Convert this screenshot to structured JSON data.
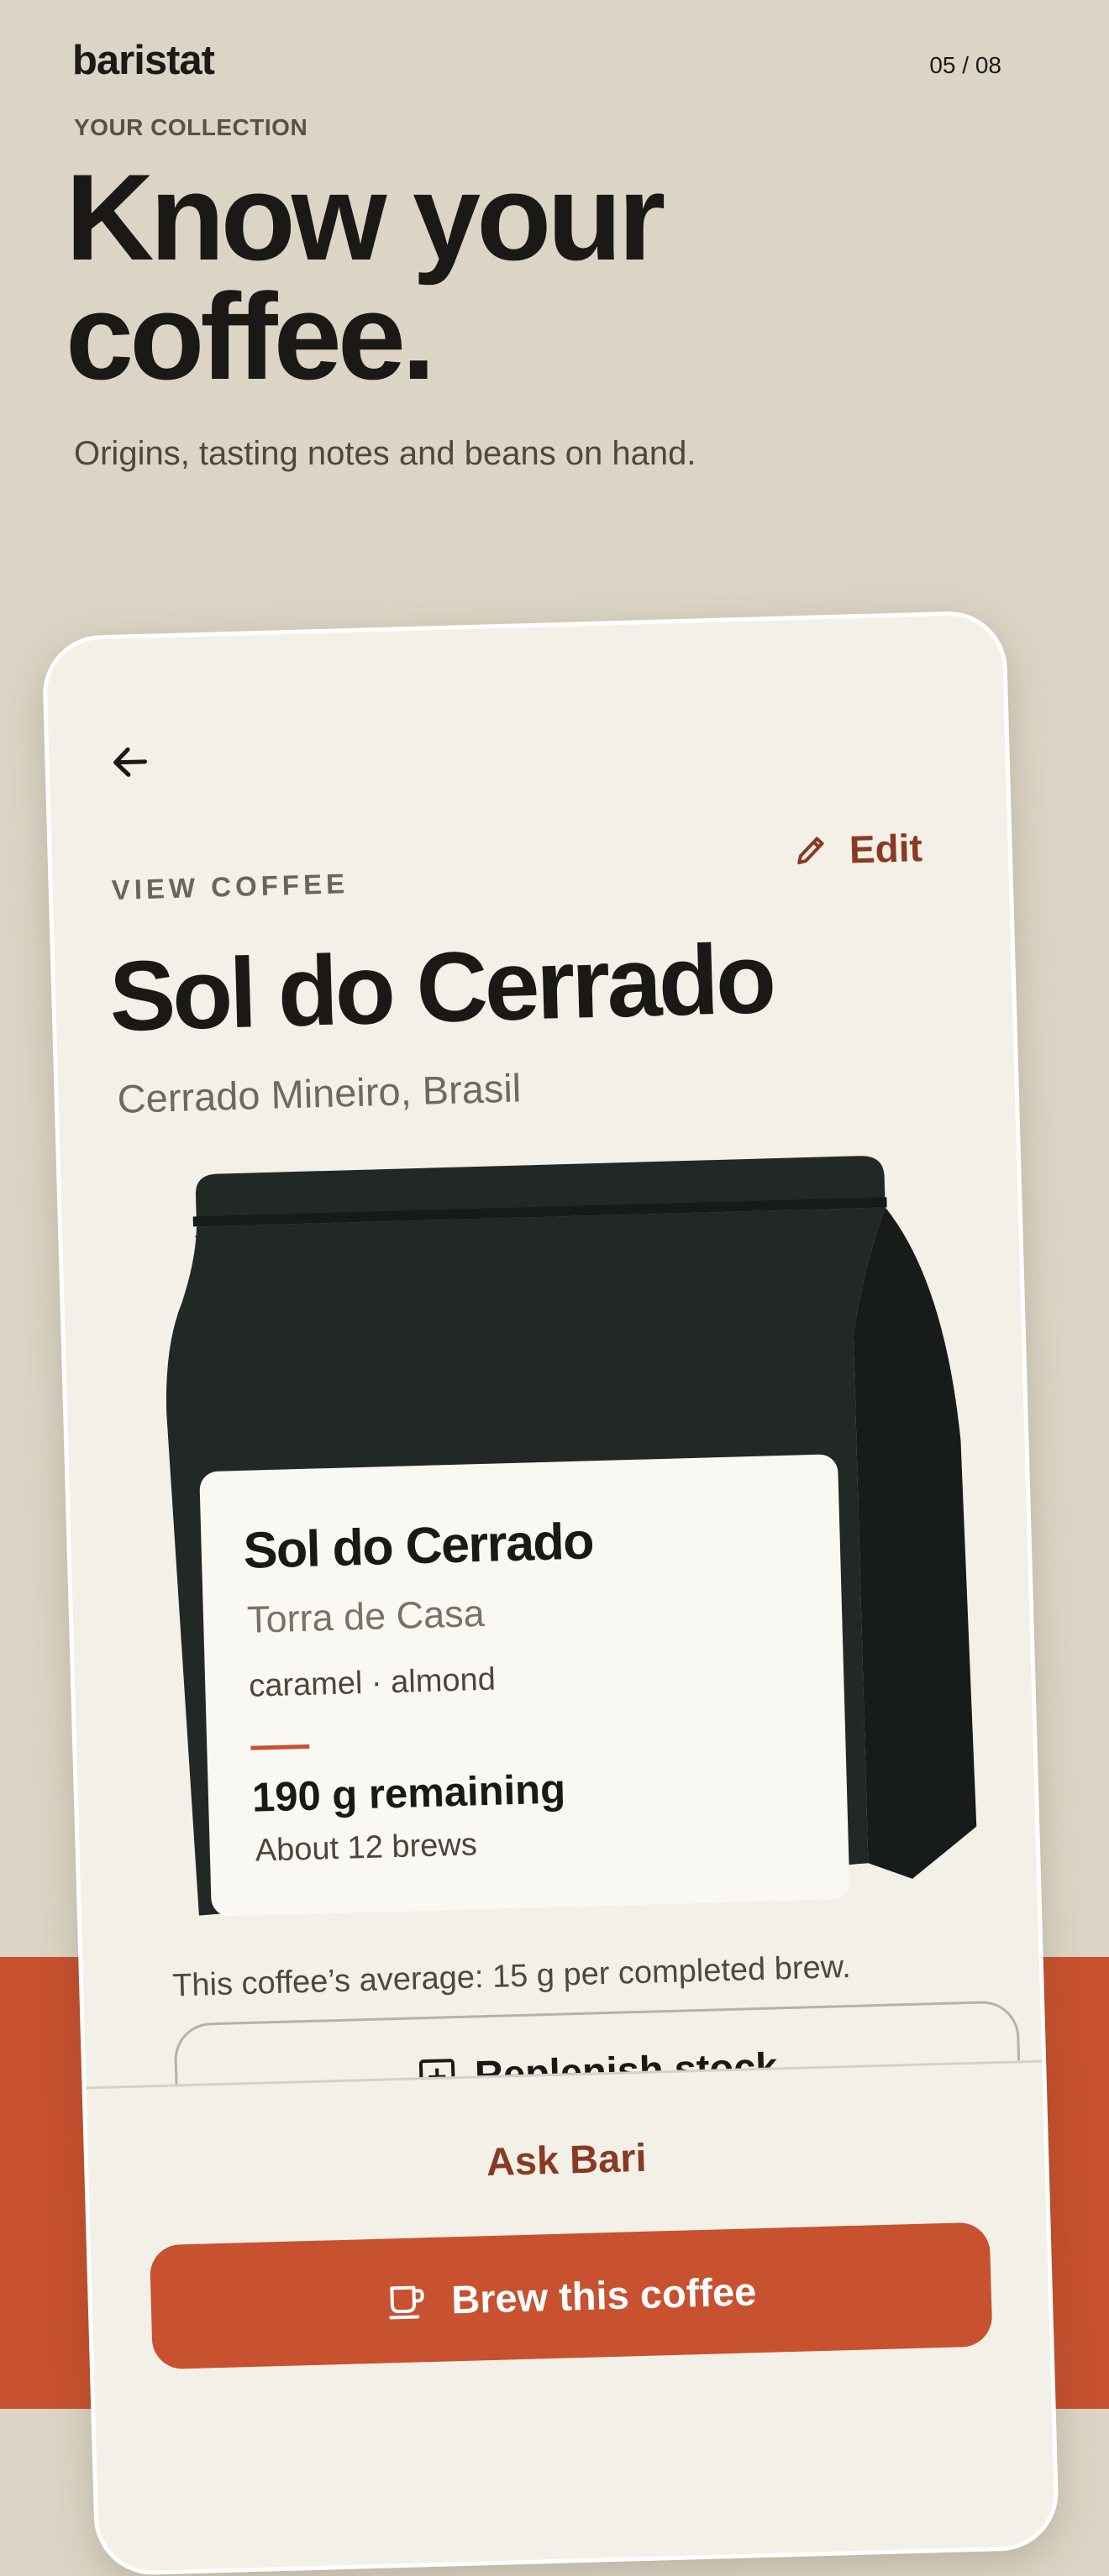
{
  "header": {
    "brand": "baristat",
    "pager": "05 / 08",
    "eyebrow": "YOUR COLLECTION",
    "headline_line1": "Know your",
    "headline_line2": "coffee.",
    "subhead": "Origins, tasting notes and beans on hand."
  },
  "screen": {
    "back_icon": "arrow-left-icon",
    "section_label": "VIEW COFFEE",
    "edit_label": "Edit",
    "edit_icon": "pencil-icon",
    "coffee_name": "Sol do Cerrado",
    "origin": "Cerrado Mineiro, Brasil",
    "bag": {
      "name": "Sol do Cerrado",
      "roaster": "Torra de Casa",
      "notes": "caramel · almond",
      "remaining": "190 g remaining",
      "brews": "About 12 brews"
    },
    "average_note": "This coffee’s average: 15 g per completed brew.",
    "replenish_label": "Replenish stock",
    "replenish_icon": "plus-square-icon",
    "ask_label": "Ask Bari",
    "brew_label": "Brew this coffee",
    "brew_icon": "coffee-cup-icon"
  },
  "colors": {
    "background": "#dcd5c5",
    "accent": "#c8512f",
    "accent_text": "#8a3a22",
    "card": "#f3f0e8",
    "bag": "#222826"
  }
}
